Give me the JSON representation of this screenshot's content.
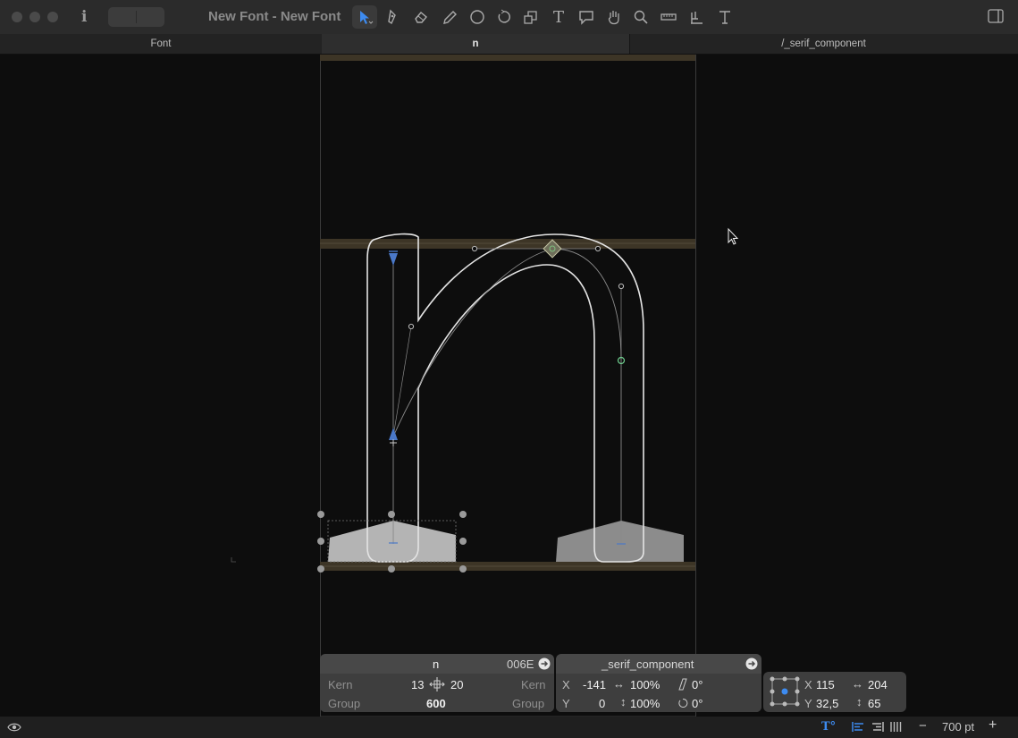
{
  "window": {
    "title": "New Font - New Font"
  },
  "toolbar": {
    "info_icon": "i",
    "tools": [
      {
        "name": "select-tool-icon",
        "active": true
      },
      {
        "name": "draw-tool-icon",
        "active": false
      },
      {
        "name": "eraser-tool-icon",
        "active": false
      },
      {
        "name": "pencil-tool-icon",
        "active": false
      },
      {
        "name": "shape-tool-icon",
        "active": false
      },
      {
        "name": "rotate-tool-icon",
        "active": false
      },
      {
        "name": "scale-tool-icon",
        "active": false
      },
      {
        "name": "text-tool-icon",
        "active": false
      },
      {
        "name": "annotation-tool-icon",
        "active": false
      },
      {
        "name": "hand-tool-icon",
        "active": false
      },
      {
        "name": "zoom-tool-icon",
        "active": false
      },
      {
        "name": "measure-tool-icon",
        "active": false
      },
      {
        "name": "primitives-tool-icon",
        "active": false
      },
      {
        "name": "text-anchor-tool-icon",
        "active": false
      }
    ],
    "text_tool_glyph": "T"
  },
  "tabs": [
    {
      "label": "Font",
      "active": false
    },
    {
      "label": "n",
      "active": true
    },
    {
      "label": "/_serif_component",
      "active": false
    }
  ],
  "glyph_panel": {
    "name": "n",
    "unicode": "006E",
    "kern_label_left": "Kern",
    "kern_left": "13",
    "kern_right": "20",
    "kern_label_right": "Kern",
    "group_label_left": "Group",
    "width": "600",
    "group_label_right": "Group"
  },
  "component_panel": {
    "name": "_serif_component",
    "x_label": "X",
    "x_value": "-141",
    "scale_x": "100%",
    "slant": "0°",
    "y_label": "Y",
    "y_value": "0",
    "scale_y": "100%",
    "rotation": "0°"
  },
  "transform_panel": {
    "x_label": "X",
    "x_value": "115",
    "width": "204",
    "y_label": "Y",
    "y_value": "32,5",
    "height": "65"
  },
  "bottom_bar": {
    "zoom": "700 pt",
    "minus": "−",
    "plus": "+"
  },
  "colors": {
    "accent": "#3d8bf0",
    "metric_band": "#3d3526",
    "canvas": "#0d0d0d",
    "panel": "#484848"
  }
}
